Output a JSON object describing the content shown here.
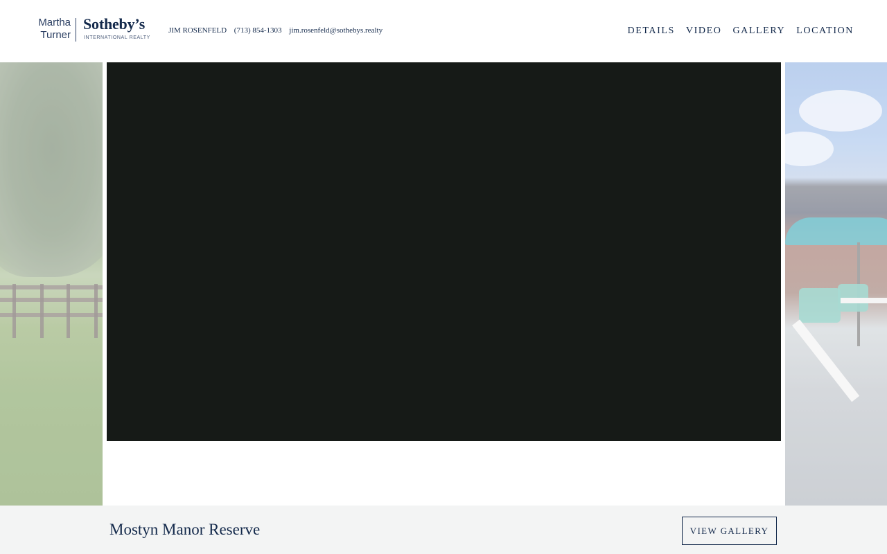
{
  "brand": {
    "logo_left_line1": "Martha",
    "logo_left_line2": "Turner",
    "logo_right": "Sotheby’s",
    "logo_sub": "INTERNATIONAL REALTY"
  },
  "contact": {
    "agent_name": "JIM ROSENFELD",
    "phone": "(713) 854-1303",
    "email": "jim.rosenfeld@sothebys.realty"
  },
  "nav": {
    "items": [
      {
        "label": "DETAILS"
      },
      {
        "label": "VIDEO"
      },
      {
        "label": "GALLERY"
      },
      {
        "label": "LOCATION"
      }
    ]
  },
  "footer": {
    "property_title": "Mostyn Manor Reserve",
    "view_gallery_label": "VIEW GALLERY"
  },
  "colors": {
    "brand_navy": "#13294b",
    "video_bg": "#161a17",
    "bar_bg": "#f3f4f4"
  }
}
